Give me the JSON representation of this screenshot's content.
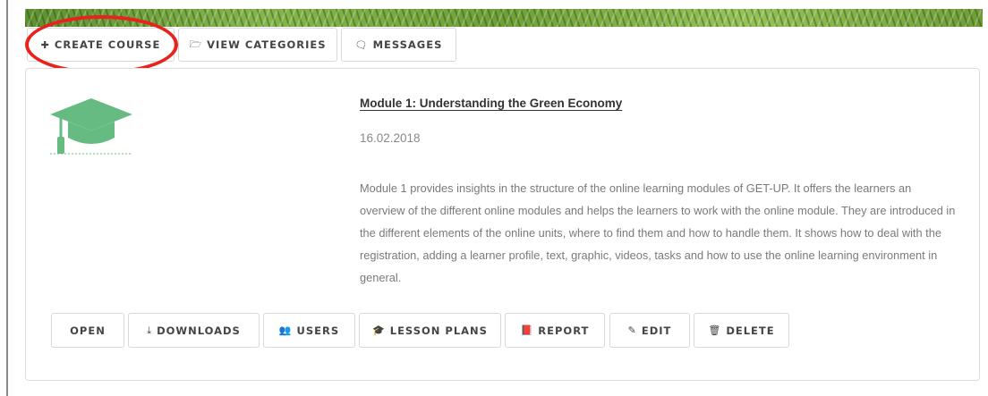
{
  "toolbar": {
    "create_course": "CREATE COURSE",
    "view_categories": "VIEW CATEGORIES",
    "messages": "MESSAGES"
  },
  "course": {
    "title": "Module 1: Understanding the Green Economy",
    "date": "16.02.2018",
    "description": "Module 1 provides insights in the structure of the online learning modules of GET-UP. It offers the learners an overview of the different online modules and helps the learners to work with the online module. They are introduced in the different elements of the online units, where to find them and how to handle them. It shows how to deal with the registration, adding a learner profile, text, graphic, videos, tasks and how to use the online learning environment in general."
  },
  "actions": {
    "open": "OPEN",
    "downloads": "DOWNLOADS",
    "users": "USERS",
    "lesson_plans": "LESSON PLANS",
    "report": "REPORT",
    "edit": "EDIT",
    "delete": "DELETE"
  },
  "icons": {
    "logo": "graduation-cap-icon",
    "create_course": "plus-icon",
    "view_categories": "folder-open-icon",
    "messages": "comments-icon",
    "downloads": "download-icon",
    "users": "users-icon",
    "lesson_plans": "graduation-cap-icon",
    "report": "book-icon",
    "edit": "pencil-icon",
    "delete": "trash-icon"
  },
  "colors": {
    "logo_green": "#66bb82",
    "annotation_red": "#e8231d",
    "border": "#dcdcdc"
  }
}
